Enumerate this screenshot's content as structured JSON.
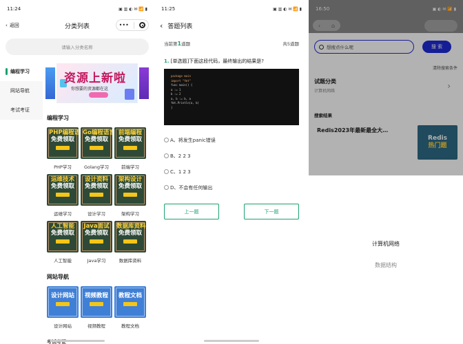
{
  "panel1": {
    "status_time": "11:24",
    "status_icons": "▣ ▥ ◐ ✉ 📶 ▮",
    "back_label": "返回",
    "title": "分类列表",
    "search_placeholder": "请输入分类名称",
    "sidebar": [
      {
        "label": "编程学习",
        "active": true
      },
      {
        "label": "网站导航",
        "active": false
      },
      {
        "label": "考试考证",
        "active": false
      }
    ],
    "banner": {
      "title": "资源上新啦",
      "subtitle": "你想要的资源都在这"
    },
    "sections": [
      {
        "title": "编程学习",
        "items": [
          {
            "line1": "PHP编程语言",
            "line2": "免费领取",
            "caption": "PHP学习"
          },
          {
            "line1": "Go编程语言",
            "line2": "免费领取",
            "caption": "Golang学习"
          },
          {
            "line1": "前端编程",
            "line2": "免费领取",
            "caption": "前端学习"
          },
          {
            "line1": "运维技术",
            "line2": "免费领取",
            "caption": "运维学习"
          },
          {
            "line1": "设计资料",
            "line2": "免费领取",
            "caption": "设计学习"
          },
          {
            "line1": "架构设计",
            "line2": "免费领取",
            "caption": "架构学习"
          },
          {
            "line1": "人工智能",
            "line2": "免费领取",
            "caption": "人工智能"
          },
          {
            "line1": "Java面试",
            "line2": "免费领取",
            "caption": "Java学习"
          },
          {
            "line1": "数据库资料",
            "line2": "免费领取",
            "caption": "数据库资料"
          }
        ]
      },
      {
        "title": "网站导航",
        "items": [
          {
            "line1": "设计网站",
            "line2": "",
            "caption": "设计网站"
          },
          {
            "line1": "视频教程",
            "line2": "",
            "caption": "视频教程"
          },
          {
            "line1": "教程文档",
            "line2": "",
            "caption": "教程文档"
          }
        ]
      }
    ],
    "cut_section": "考试考证"
  },
  "panel2": {
    "status_time": "11:25",
    "status_icons": "▣ ▥ ◐ ✉ 📶 ▮",
    "title": "答题列表",
    "progress_prefix": "当前第",
    "progress_num": "1",
    "progress_suffix": "道题",
    "total": "共5道题",
    "q_num": "1.",
    "q_text": "[单选题]下面这段代码，最终输出的结果是?",
    "code_lines": [
      "package main",
      "import \"fmt\"",
      "func main() {",
      "    a := 1",
      "    b := 2",
      "    a, b := b, a",
      "    fmt.Println(a, b)",
      "}"
    ],
    "options": [
      "A、将发生panic错误",
      "B、2 2 3",
      "C、1 2 3",
      "D、不会有任何输出"
    ],
    "prev_label": "上一题",
    "next_label": "下一题"
  },
  "panel3": {
    "status_time": "16:50",
    "status_icons": "▣ ◐ ✉ 📶 ▮",
    "search_placeholder": "想搜点什么呢",
    "search_button": "搜 索",
    "filter_label": "清除搜索条件",
    "category_label": "试题分类",
    "category_value": "计算机网络",
    "results_title": "搜索结果",
    "result_title": "Redis2023年最新最全大…",
    "result_thumb_line1": "Redis",
    "result_thumb_line2": "热门题",
    "sheet_options": [
      "计算机网络",
      "数据结构"
    ]
  }
}
